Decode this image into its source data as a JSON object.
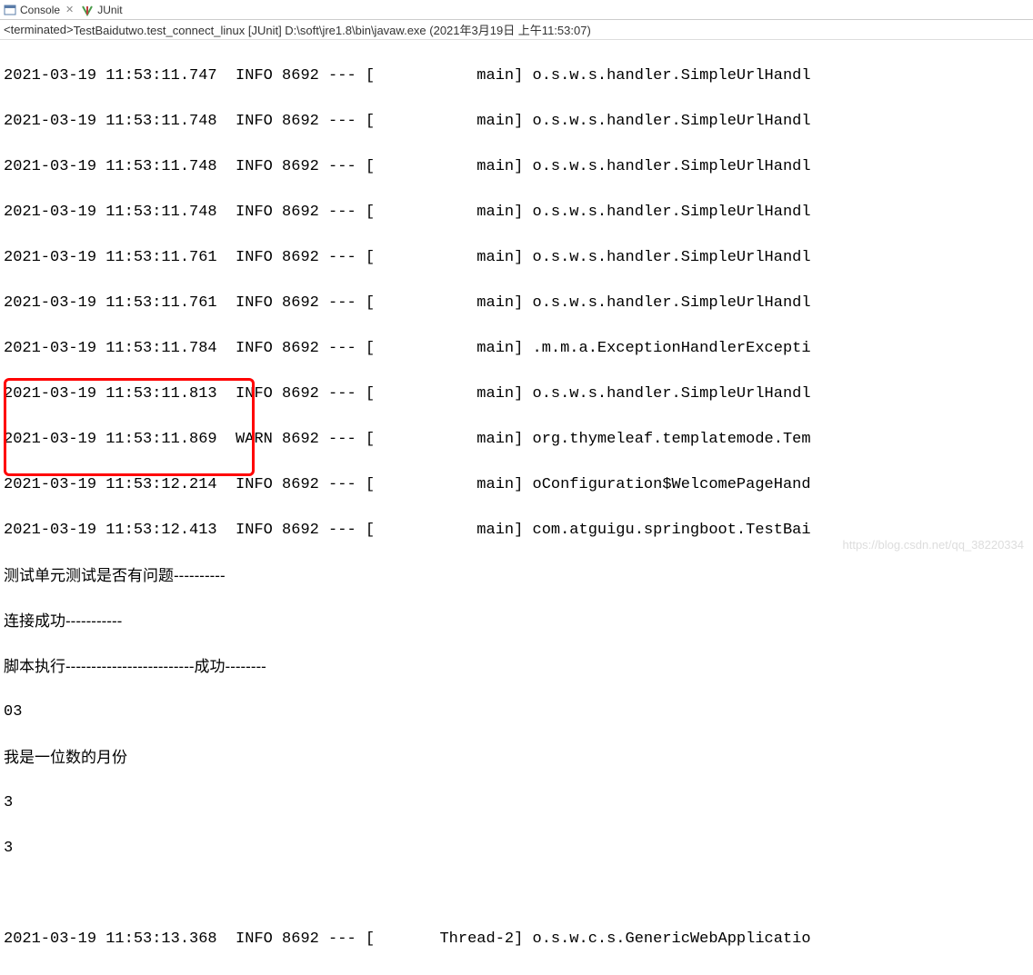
{
  "tabs": {
    "console": {
      "label": "Console",
      "icon": "console-icon"
    },
    "junit": {
      "label": "JUnit",
      "icon": "junit-icon"
    }
  },
  "header": {
    "status": "<terminated>",
    "text": " TestBaidutwo.test_connect_linux [JUnit] D:\\soft\\jre1.8\\bin\\javaw.exe (2021年3月19日 上午11:53:07)"
  },
  "logs": [
    "2021-03-19 11:53:11.747  INFO 8692 --- [           main] o.s.w.s.handler.SimpleUrlHandl",
    "2021-03-19 11:53:11.748  INFO 8692 --- [           main] o.s.w.s.handler.SimpleUrlHandl",
    "2021-03-19 11:53:11.748  INFO 8692 --- [           main] o.s.w.s.handler.SimpleUrlHandl",
    "2021-03-19 11:53:11.748  INFO 8692 --- [           main] o.s.w.s.handler.SimpleUrlHandl",
    "2021-03-19 11:53:11.761  INFO 8692 --- [           main] o.s.w.s.handler.SimpleUrlHandl",
    "2021-03-19 11:53:11.761  INFO 8692 --- [           main] o.s.w.s.handler.SimpleUrlHandl",
    "2021-03-19 11:53:11.784  INFO 8692 --- [           main] .m.m.a.ExceptionHandlerExcepti",
    "2021-03-19 11:53:11.813  INFO 8692 --- [           main] o.s.w.s.handler.SimpleUrlHandl",
    "2021-03-19 11:53:11.869  WARN 8692 --- [           main] org.thymeleaf.templatemode.Tem",
    "2021-03-19 11:53:12.214  INFO 8692 --- [           main] oConfiguration$WelcomePageHand",
    "2021-03-19 11:53:12.413  INFO 8692 --- [           main] com.atguigu.springboot.TestBai"
  ],
  "messages": {
    "line1": "测试单元测试是否有问题----------",
    "line2": "连接成功-----------",
    "line3": "脚本执行-------------------------成功--------",
    "line4": "03",
    "line5": "我是一位数的月份",
    "line6": "3",
    "line7": "3"
  },
  "finalLog": "2021-03-19 11:53:13.368  INFO 8692 --- [       Thread-2] o.s.w.c.s.GenericWebApplicatio",
  "watermark": "https://blog.csdn.net/qq_38220334"
}
